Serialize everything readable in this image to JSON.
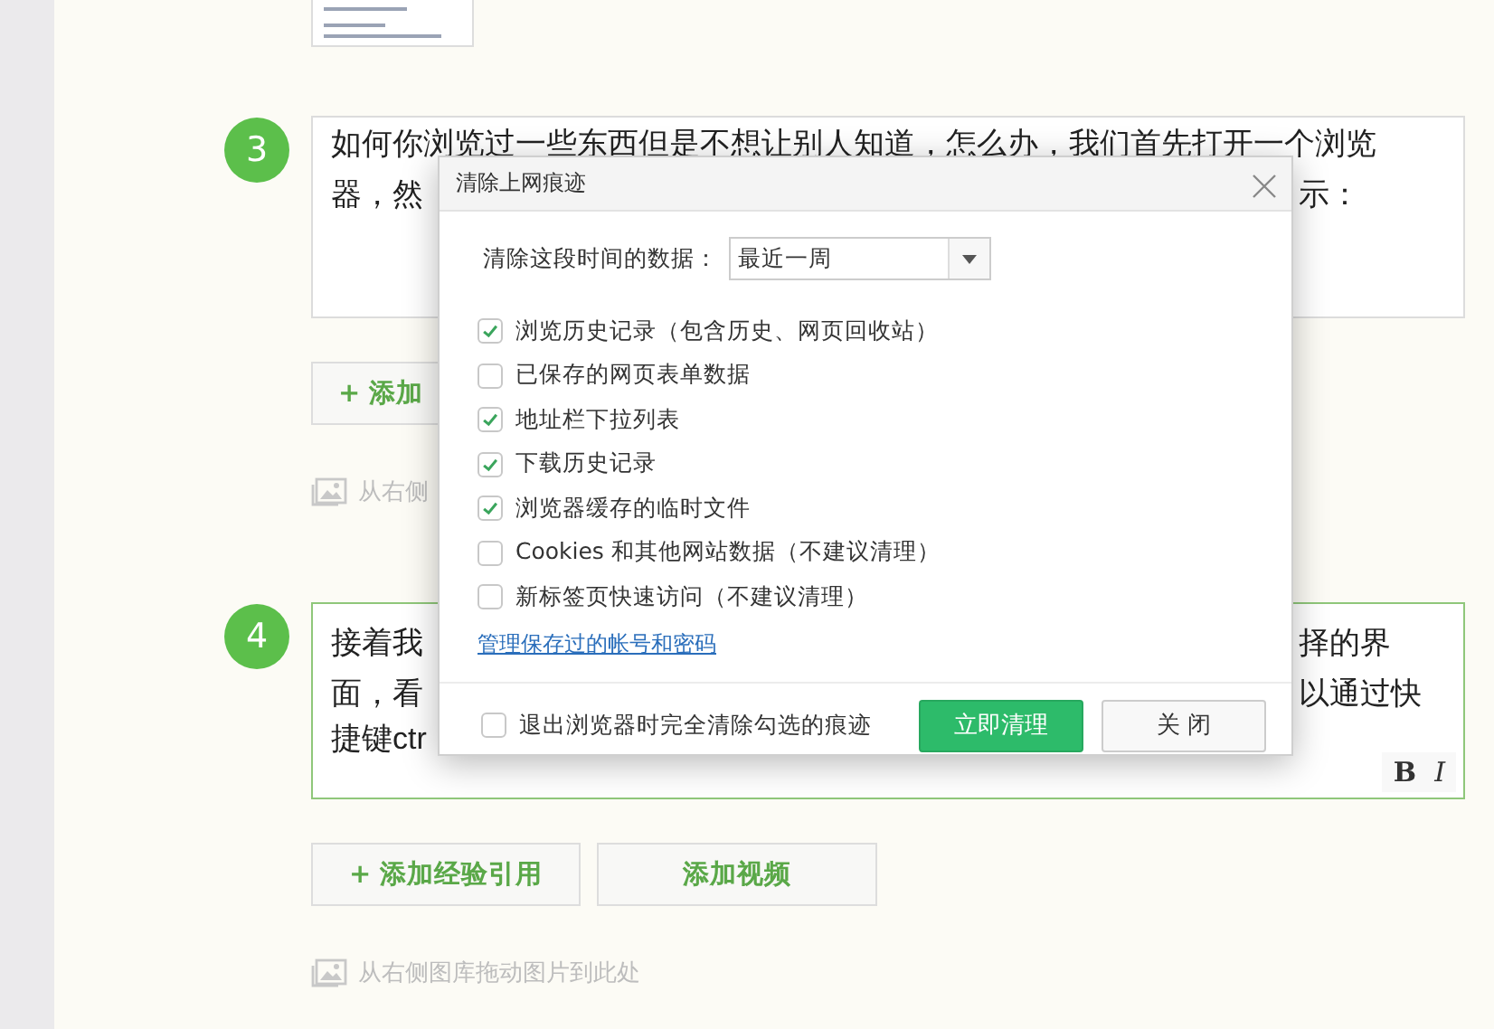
{
  "steps": [
    {
      "number": "3",
      "focused": false,
      "lines": [
        {
          "left": "如何你浏览过一些东西但是不想让别人知道，怎么办，我们首先打开一个浏览"
        },
        {
          "left": "器，然",
          "right": "示："
        }
      ],
      "buttons": [
        {
          "prefix": "+",
          "label": "添加"
        }
      ],
      "hint": "从右侧"
    },
    {
      "number": "4",
      "focused": true,
      "lines": [
        {
          "left": "接着我",
          "right": "择的界"
        },
        {
          "left": "面，看",
          "right": "以通过快"
        },
        {
          "left": "捷键ctr"
        }
      ],
      "format_buttons": [
        {
          "label": "B",
          "kind": "bold"
        },
        {
          "label": "I",
          "kind": "italic"
        }
      ],
      "buttons": [
        {
          "prefix": "+",
          "label": "添加经验引用"
        },
        {
          "label": "添加视频"
        }
      ],
      "hint": "从右侧图库拖动图片到此处"
    }
  ],
  "dialog": {
    "title": "清除上网痕迹",
    "range_label": "清除这段时间的数据：",
    "range_value": "最近一周",
    "options": [
      {
        "label": "浏览历史记录（包含历史、网页回收站）",
        "checked": true
      },
      {
        "label": "已保存的网页表单数据",
        "checked": false
      },
      {
        "label": "地址栏下拉列表",
        "checked": true
      },
      {
        "label": "下载历史记录",
        "checked": true
      },
      {
        "label": "浏览器缓存的临时文件",
        "checked": true
      },
      {
        "label": "Cookies 和其他网站数据（不建议清理）",
        "checked": false
      },
      {
        "label": "新标签页快速访问（不建议清理）",
        "checked": false
      }
    ],
    "link": "管理保存过的帐号和密码",
    "exit_option": {
      "label": "退出浏览器时完全清除勾选的痕迹",
      "checked": false
    },
    "buttons": [
      {
        "label": "立即清理",
        "kind": "primary"
      },
      {
        "label": "关 闭",
        "kind": "secondary"
      }
    ]
  }
}
